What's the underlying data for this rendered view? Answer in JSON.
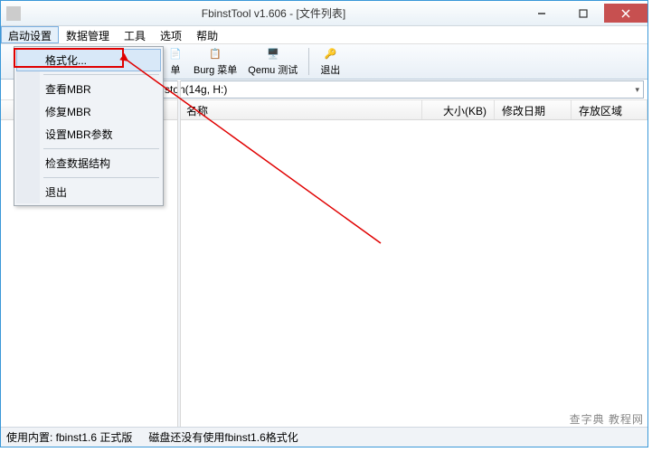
{
  "title": "FbinstTool v1.606 - [文件列表]",
  "menus": {
    "m0": "启动设置",
    "m1": "数据管理",
    "m2": "工具",
    "m3": "选项",
    "m4": "帮助"
  },
  "toolbar": {
    "t0": "单",
    "t1": "Burg 菜单",
    "t2": "Qemu 测试",
    "t3": "退出"
  },
  "combo": {
    "text": "ston(14g, H:)"
  },
  "columns": {
    "c0": "名称",
    "c1": "大小(KB)",
    "c2": "修改日期",
    "c3": "存放区域"
  },
  "dropdown": {
    "d0": "格式化...",
    "d1": "查看MBR",
    "d2": "修复MBR",
    "d3": "设置MBR参数",
    "d4": "检查数据结构",
    "d5": "退出"
  },
  "status": {
    "s0": "使用内置: fbinst1.6 正式版",
    "s1": "磁盘还没有使用fbinst1.6格式化"
  },
  "watermark": "查字典 教程网"
}
